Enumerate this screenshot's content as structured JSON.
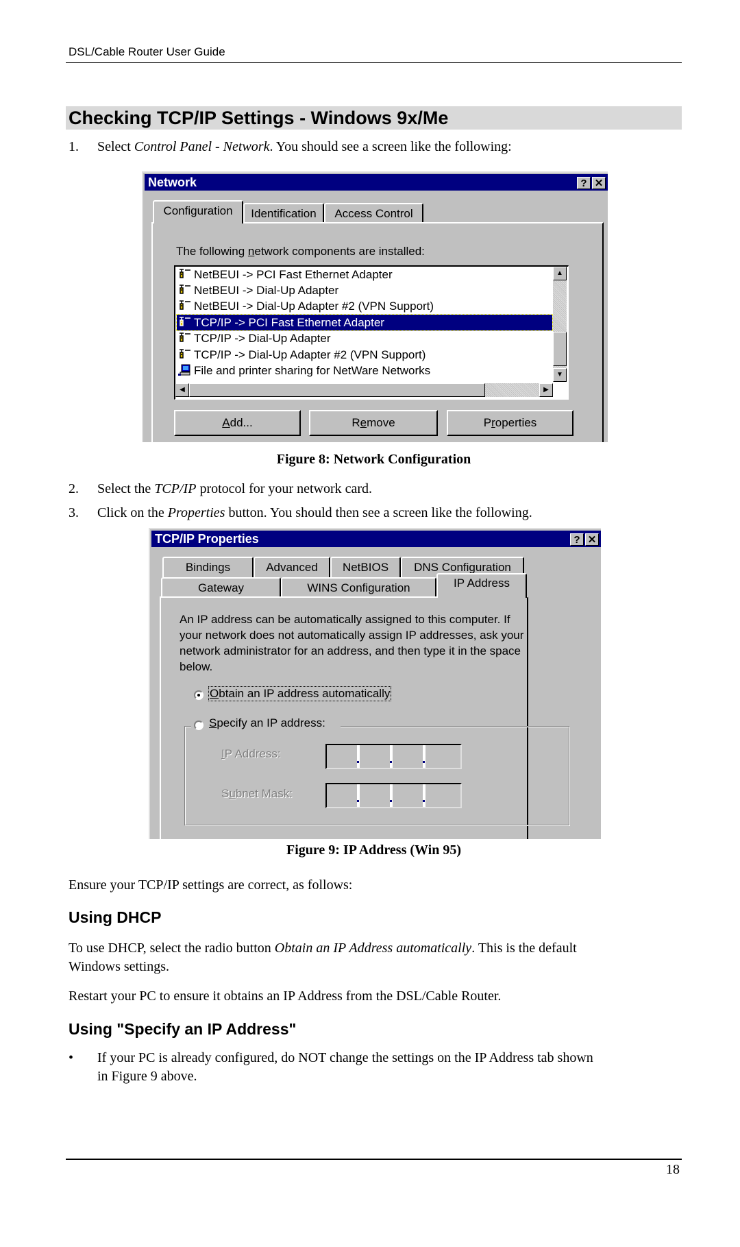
{
  "page": {
    "running_header": "DSL/Cable Router User Guide",
    "section_title": "Checking TCP/IP Settings - Windows 9x/Me",
    "page_number": "18"
  },
  "steps": [
    {
      "num": "1.",
      "pre": "Select ",
      "em": "Control Panel - Network",
      "post": ". You should see a screen like the following:"
    },
    {
      "num": "2.",
      "pre": "Select the ",
      "em": "TCP/IP",
      "post": " protocol for your network card."
    },
    {
      "num": "3.",
      "pre": "Click on the ",
      "em": "Properties",
      "post": " button. You should then see a screen like the following."
    }
  ],
  "figure8": {
    "caption": "Figure 8: Network Configuration",
    "dialog": {
      "title": "Network",
      "help_button": "?",
      "close_button": "✕",
      "tabs": [
        {
          "label": "Configuration",
          "active": true
        },
        {
          "label": "Identification",
          "active": false
        },
        {
          "label": "Access Control",
          "active": false
        }
      ],
      "list_label_pre": "The following ",
      "list_label_u": "n",
      "list_label_post": "etwork components are installed:",
      "components": [
        {
          "label": "NetBEUI -> PCI Fast Ethernet Adapter",
          "icon": "network-protocol-icon",
          "selected": false
        },
        {
          "label": "NetBEUI -> Dial-Up Adapter",
          "icon": "network-protocol-icon",
          "selected": false
        },
        {
          "label": "NetBEUI -> Dial-Up Adapter #2 (VPN Support)",
          "icon": "network-protocol-icon",
          "selected": false
        },
        {
          "label": "TCP/IP -> PCI Fast Ethernet Adapter",
          "icon": "network-protocol-icon",
          "selected": true
        },
        {
          "label": "TCP/IP -> Dial-Up Adapter",
          "icon": "network-protocol-icon",
          "selected": false
        },
        {
          "label": "TCP/IP -> Dial-Up Adapter #2 (VPN Support)",
          "icon": "network-protocol-icon",
          "selected": false
        },
        {
          "label": "File and printer sharing for NetWare Networks",
          "icon": "computer-service-icon",
          "selected": false
        }
      ],
      "buttons": {
        "add_u": "A",
        "add_rest": "dd...",
        "remove_pre": "R",
        "remove_u": "e",
        "remove_post": "move",
        "properties_pre": "P",
        "properties_u": "r",
        "properties_post": "operties"
      }
    }
  },
  "figure9": {
    "caption": "Figure 9: IP Address (Win 95)",
    "dialog": {
      "title": "TCP/IP Properties",
      "help_button": "?",
      "close_button": "✕",
      "tabs_row1": [
        "Bindings",
        "Advanced",
        "NetBIOS",
        "DNS Configuration"
      ],
      "tabs_row2": [
        "Gateway",
        "WINS Configuration",
        "IP Address"
      ],
      "active_tab": "IP Address",
      "description_lines": [
        "An IP address can be automatically assigned to this computer.  If",
        "your network does not automatically assign IP addresses, ask your",
        "network administrator for an address, and then type it in the space",
        "below."
      ],
      "radio_obtain_u": "O",
      "radio_obtain_rest": "btain an IP address automatically",
      "radio_obtain_checked": true,
      "radio_specify_u": "S",
      "radio_specify_rest": "pecify an IP address:",
      "radio_specify_checked": false,
      "ip_address_u": "I",
      "ip_address_rest": "P Address:",
      "subnet_pre": "S",
      "subnet_u": "u",
      "subnet_post": "bnet Mask:",
      "ip_address_value": [
        "",
        "",
        "",
        ""
      ],
      "subnet_mask_value": [
        "",
        "",
        "",
        ""
      ]
    }
  },
  "body": {
    "ensure": "Ensure your TCP/IP settings are correct, as follows:",
    "dhcp_heading": "Using DHCP",
    "dhcp_para_pre": "To use DHCP, select the radio button ",
    "dhcp_para_em": "Obtain an IP Address automatically",
    "dhcp_para_post": ". This is the default",
    "dhcp_para_line2": "Windows settings.",
    "restart": "Restart your PC to ensure it obtains an IP Address from the DSL/Cable Router.",
    "specify_heading": "Using \"Specify an IP Address\"",
    "bullet_line1": "If your PC is already configured, do NOT change the settings on the IP Address tab shown",
    "bullet_line2": "in Figure 9 above."
  },
  "colors": {
    "titlebar": "#000080",
    "dialog_face": "#c0c0c0",
    "heading_band": "#d9d9d9"
  }
}
